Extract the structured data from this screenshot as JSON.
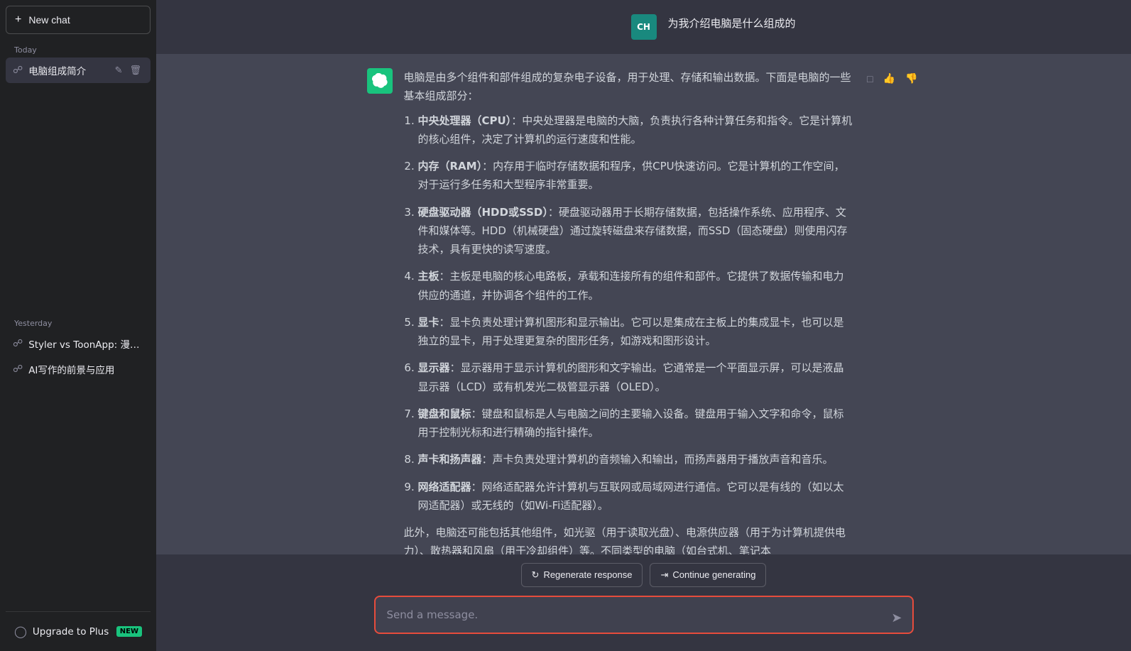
{
  "sidebar": {
    "new_chat_label": "New chat",
    "plus_icon": "+",
    "today_label": "Today",
    "yesterday_label": "Yesterday",
    "today_items": [
      {
        "id": "dian-nao",
        "text": "电脑组成简介",
        "active": true
      }
    ],
    "yesterday_items": [
      {
        "id": "styler",
        "text": "Styler vs ToonApp: 漫画脸优劣"
      },
      {
        "id": "ai-writing",
        "text": "AI写作的前景与应用"
      }
    ],
    "upgrade_label": "Upgrade to Plus",
    "new_badge": "NEW"
  },
  "chat": {
    "user_avatar_text": "CH",
    "ai_avatar_text": "✦",
    "user_message": "为我介绍电脑是什么组成的",
    "ai_intro": "电脑是由多个组件和部件组成的复杂电子设备，用于处理、存储和输出数据。下面是电脑的一些基本组成部分：",
    "ai_items": [
      {
        "num": 1,
        "title": "中央处理器（CPU）",
        "text": "中央处理器是电脑的大脑，负责执行各种计算任务和指令。它是计算机的核心组件，决定了计算机的运行速度和性能。"
      },
      {
        "num": 2,
        "title": "内存（RAM）",
        "text": "内存用于临时存储数据和程序，供CPU快速访问。它是计算机的工作空间，对于运行多任务和大型程序非常重要。"
      },
      {
        "num": 3,
        "title": "硬盘驱动器（HDD或SSD）",
        "text": "硬盘驱动器用于长期存储数据，包括操作系统、应用程序、文件和媒体等。HDD（机械硬盘）通过旋转磁盘来存储数据，而SSD（固态硬盘）则使用闪存技术，具有更快的读写速度。"
      },
      {
        "num": 4,
        "title": "主板",
        "text": "主板是电脑的核心电路板，承载和连接所有的组件和部件。它提供了数据传输和电力供应的通道，并协调各个组件的工作。"
      },
      {
        "num": 5,
        "title": "显卡",
        "text": "显卡负责处理计算机图形和显示输出。它可以是集成在主板上的集成显卡，也可以是独立的显卡，用于处理更复杂的图形任务，如游戏和图形设计。"
      },
      {
        "num": 6,
        "title": "显示器",
        "text": "显示器用于显示计算机的图形和文字输出。它通常是一个平面显示屏，可以是液晶显示器（LCD）或有机发光二极管显示器（OLED）。"
      },
      {
        "num": 7,
        "title": "键盘和鼠标",
        "text": "键盘和鼠标是人与电脑之间的主要输入设备。键盘用于输入文字和命令，鼠标用于控制光标和进行精确的指针操作。"
      },
      {
        "num": 8,
        "title": "声卡和扬声器",
        "text": "声卡负责处理计算机的音频输入和输出，而扬声器用于播放声音和音乐。"
      },
      {
        "num": 9,
        "title": "网络适配器",
        "text": "网络适配器允许计算机与互联网或局域网进行通信。它可以是有线的（如以太网适配器）或无线的（如Wi-Fi适配器）。"
      }
    ],
    "ai_footer": "此外，电脑还可能包括其他组件，如光驱（用于读取光盘）、电源供应器（用于为计算机提供电力）、散热器和风扇（用于冷却组件）等。不同类型的电脑（如台式机、笔记本",
    "regenerate_label": "Regenerate response",
    "continue_label": "Continue generating",
    "input_placeholder": "Send a message.",
    "send_icon": "➤"
  }
}
